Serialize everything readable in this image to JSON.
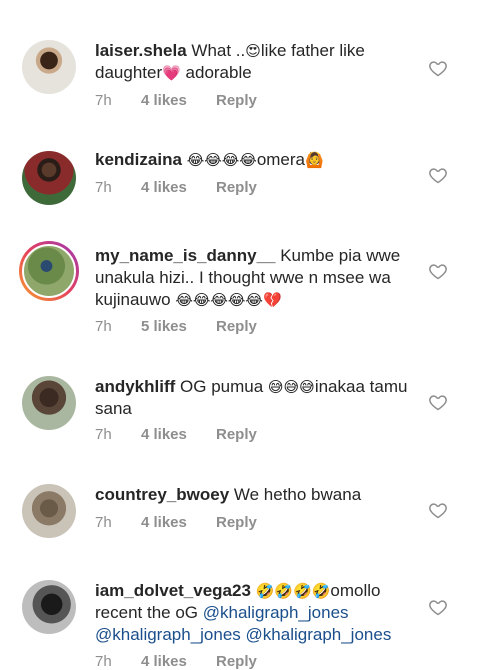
{
  "comments": [
    {
      "username": "laiser.shela",
      "text_a": " What ..",
      "emoji_a": "😍",
      "text_b": "like father like daughter",
      "emoji_b": "💗",
      "text_c": " adorable",
      "time": "7h",
      "likes": "4 likes",
      "reply": "Reply"
    },
    {
      "username": "kendizaina",
      "emoji_a": " 😂😂😂😂",
      "text_a": "omera",
      "emoji_b": "🙆",
      "time": "7h",
      "likes": "4 likes",
      "reply": "Reply"
    },
    {
      "username": "my_name_is_danny__",
      "text_a": " Kumbe pia wwe unakula hizi.. I thought wwe n msee wa kujinauwo ",
      "emoji_a": "😂😂😂😂😂💔",
      "time": "7h",
      "likes": "5 likes",
      "reply": "Reply"
    },
    {
      "username": "andykhliff",
      "text_a": " OG pumua ",
      "emoji_a": "😅😅😅",
      "text_b": "inakaa tamu sana",
      "time": "7h",
      "likes": "4 likes",
      "reply": "Reply"
    },
    {
      "username": "countrey_bwoey",
      "text_a": " We hetho bwana",
      "time": "7h",
      "likes": "4 likes",
      "reply": "Reply"
    },
    {
      "username": "iam_dolvet_vega23",
      "emoji_a": " 🤣🤣🤣🤣",
      "text_a": "omollo recent the oG ",
      "mention_1": "@khaligraph_jones",
      "mention_2": "@khaligraph_jones",
      "mention_3": "@khaligraph_jones",
      "time": "7h",
      "likes": "4 likes",
      "reply": "Reply"
    }
  ],
  "colors": {
    "text": "#262626",
    "meta": "#8e8e8e",
    "mention": "#1b4f8c"
  }
}
